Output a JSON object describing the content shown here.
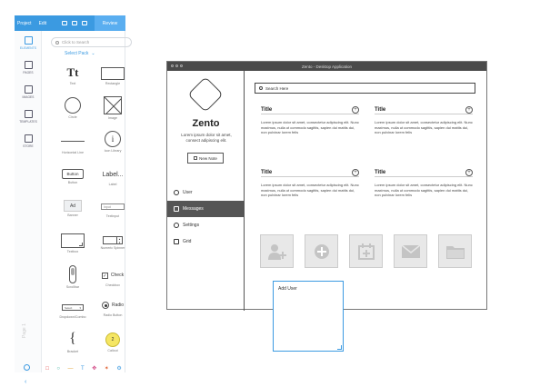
{
  "editor": {
    "menu": [
      "Project",
      "Edit"
    ],
    "review_label": "Review",
    "nav": [
      {
        "label": "ELEMENTS",
        "icon": "cube-icon"
      },
      {
        "label": "PAGES",
        "icon": "pages-icon"
      },
      {
        "label": "IMAGES",
        "icon": "images-icon"
      },
      {
        "label": "TEMPLATES",
        "icon": "templates-icon"
      },
      {
        "label": "STORE",
        "icon": "store-icon"
      }
    ],
    "page_label": "Page 1",
    "search_placeholder": "Click to Search",
    "select_pack": "Select Pack",
    "elements": {
      "text": {
        "glyph": "Tt",
        "label": "Text"
      },
      "rectangle": {
        "label": "Rectangle"
      },
      "circle": {
        "label": "Circle"
      },
      "image": {
        "label": "Image"
      },
      "horizontal_line": {
        "label": "Horizontal Line"
      },
      "icon_library": {
        "glyph": "i",
        "label": "Icon Library"
      },
      "button": {
        "text": "Button",
        "label": "Button"
      },
      "label": {
        "text": "Label...",
        "label": "Label"
      },
      "banner": {
        "text": "Ad",
        "label": "Banner"
      },
      "textinput": {
        "text": "Input",
        "label": "Textinput"
      },
      "textbox": {
        "label": "Textbox"
      },
      "numeric_spinner": {
        "label": "Numeric Spinner"
      },
      "scrollbar": {
        "label": "Scrollbar"
      },
      "checkbox": {
        "text": "Check",
        "label": "Checkbox"
      },
      "dropdown": {
        "text": "Select",
        "label": "Dropdown/Combo"
      },
      "radio": {
        "text": "Radio",
        "label": "Radio Button"
      },
      "bracket": {
        "glyph": "{",
        "label": "Bracket"
      },
      "callout": {
        "text": "2",
        "label": "Callout"
      }
    }
  },
  "window": {
    "title": "Zento - Desktop Application",
    "brand": "Zento",
    "tagline": "Lorem ipsum dolor sit amet, consect adipiscing elit.",
    "new_note": "New Note",
    "menu": [
      "User",
      "Messages",
      "Settings",
      "Grid"
    ],
    "search_placeholder": "Search Here",
    "cards": [
      {
        "title": "Title",
        "body": "Lorem ipsum dolor sit amet, consectetur adipiscing elit. Nunc maximus, nulla ut commodo sagittis, sapien dui mattis dui, non pulvinar lorem felis"
      },
      {
        "title": "Title",
        "body": "Lorem ipsum dolor sit amet, consectetur adipiscing elit. Nunc maximus, nulla ut commodo sagittis, sapien dui mattis dui, non pulvinar lorem felis"
      },
      {
        "title": "Title",
        "body": "Lorem ipsum dolor sit amet, consectetur adipiscing elit. Nunc maximus, nulla ut commodo sagittis, sapien dui mattis dui, non pulvinar lorem felis"
      },
      {
        "title": "Title",
        "body": "Lorem ipsum dolor sit amet, consectetur adipiscing elit. Nunc maximus, nulla ut commodo sagittis, sapien dui mattis dui, non pulvinar lorem felis"
      }
    ],
    "tiles": [
      "add-user-icon",
      "add-icon",
      "calendar-add-icon",
      "mail-icon",
      "folder-icon"
    ]
  },
  "add_user_box": {
    "text": "Add User"
  },
  "colors": {
    "accent": "#3b9ae1",
    "window_titlebar": "#4a4a4a",
    "active_menu": "#555555",
    "callout": "#f5e663"
  }
}
